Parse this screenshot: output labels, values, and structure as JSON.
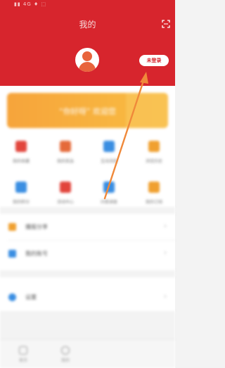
{
  "status_bar": {
    "text": "▮▮ 4G ♦ ⬚"
  },
  "header": {
    "title": "我的",
    "login_button": "未登录",
    "background_color": "#d7252d"
  },
  "banner": {
    "text": "“你好呀” 欢迎您"
  },
  "grid": [
    {
      "label": "我的收藏",
      "color": "#e2453c"
    },
    {
      "label": "我的奖品",
      "color": "#e56a3a"
    },
    {
      "label": "互动消息",
      "color": "#3a8ee2"
    },
    {
      "label": "浏览历史",
      "color": "#f0a030"
    },
    {
      "label": "我的积分",
      "color": "#3a8ee2"
    },
    {
      "label": "活动中心",
      "color": "#e2453c"
    },
    {
      "label": "问卷调查",
      "color": "#3a8ee2"
    },
    {
      "label": "我的订阅",
      "color": "#f0a030"
    }
  ],
  "menu": [
    {
      "label": "播报分享",
      "color": "#f0a030"
    },
    {
      "label": "我的账号",
      "color": "#3a8ee2"
    },
    {
      "label": "设置",
      "color": "#3a8ee2"
    }
  ],
  "tabbar": [
    {
      "label": "首页"
    },
    {
      "label": "我的"
    }
  ],
  "annotation": {
    "arrow_color": "#f0893a",
    "icon": "arrow-annotation-icon"
  }
}
